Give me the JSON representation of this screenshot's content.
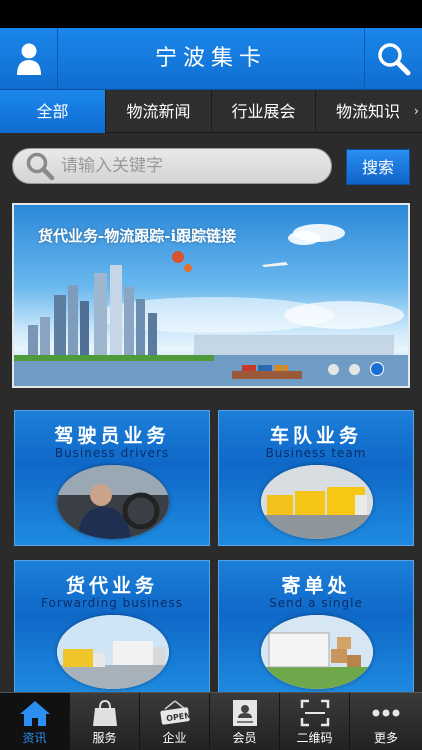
{
  "header": {
    "title": "宁波集卡",
    "left_icon": "user-icon",
    "right_icon": "search-icon"
  },
  "tabs": [
    {
      "label": "全部",
      "active": true
    },
    {
      "label": "物流新闻"
    },
    {
      "label": "行业展会"
    },
    {
      "label": "物流知识"
    }
  ],
  "search": {
    "placeholder": "请输入关键字",
    "button": "搜索"
  },
  "banner": {
    "caption": "货代业务-物流跟踪-i跟踪链接",
    "slides": 3,
    "active_slide": 3
  },
  "cards": [
    {
      "title": "驾驶员业务",
      "subtitle": "Business drivers"
    },
    {
      "title": "车队业务",
      "subtitle": "Business team"
    },
    {
      "title": "货代业务",
      "subtitle": "Forwarding business"
    },
    {
      "title": "寄单处",
      "subtitle": "Send a single"
    }
  ],
  "bottom_nav": [
    {
      "label": "资讯",
      "icon": "home-icon",
      "active": true
    },
    {
      "label": "服务",
      "icon": "bag-icon"
    },
    {
      "label": "企业",
      "icon": "open-sign-icon"
    },
    {
      "label": "会员",
      "icon": "id-card-icon"
    },
    {
      "label": "二维码",
      "icon": "qr-scan-icon"
    },
    {
      "label": "更多",
      "icon": "more-icon"
    }
  ],
  "colors": {
    "accent": "#1479dc",
    "background": "#2b2b2b"
  }
}
